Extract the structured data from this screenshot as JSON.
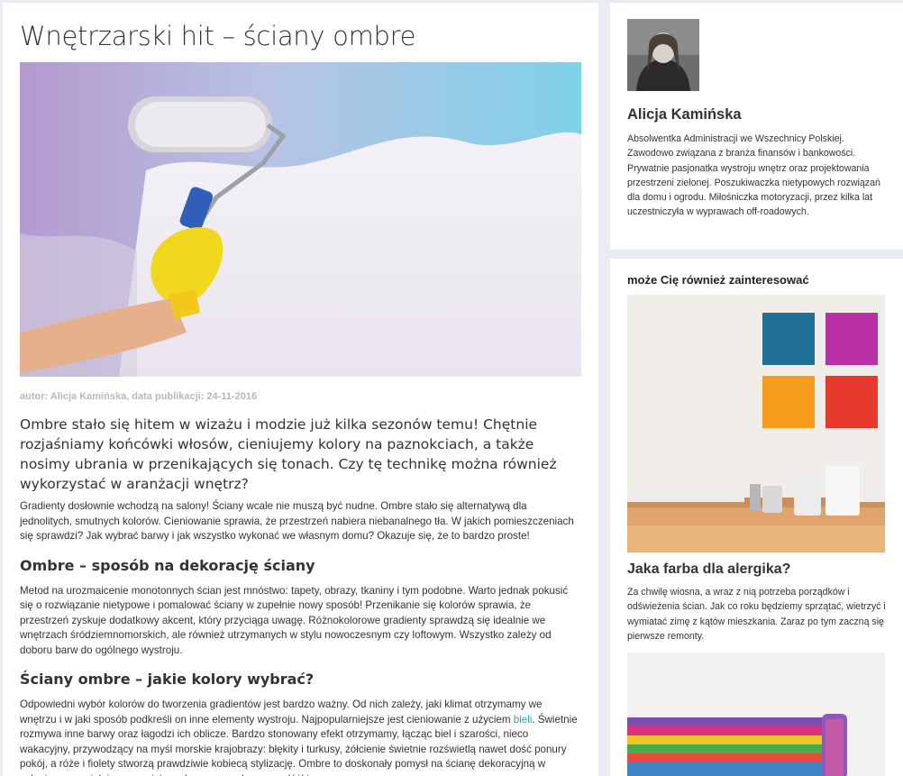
{
  "article": {
    "title": "Wnętrzarski hit – ściany ombre",
    "meta": "autor: Alicja Kamińska, data publikacji: 24-11-2016",
    "lead": "Ombre stało się hitem w wizażu i modzie już kilka sezonów temu! Chętnie rozjaśniamy końcówki włosów, cieniujemy kolory na paznokciach, a także nosimy ubrania w przenikających się tonach. Czy tę technikę można również wykorzystać w aranżacji wnętrz?",
    "intro": "Gradienty dosłownie wchodzą na salony! Ściany wcale nie muszą być nudne. Ombre stało się alternatywą dla jednolitych, smutnych kolorów. Cieniowanie sprawia, że przestrzeń nabiera niebanalnego tła. W jakich pomieszczeniach się sprawdzi? Jak wybrać barwy i jak wszystko wykonać we własnym domu? Okazuje się, że to bardzo proste!",
    "section1_heading": "Ombre – sposób na dekorację ściany",
    "section1_text": "Metod na urozmaicenie monotonnych ścian jest mnóstwo: tapety, obrazy, tkaniny i tym podobne. Warto jednak pokusić się o rozwiązanie nietypowe i pomalować ściany w zupełnie nowy sposób! Przenikanie się kolorów sprawia, że przestrzeń zyskuje dodatkowy akcent, który przyciąga uwagę. Różnokolorowe gradienty sprawdzą się idealnie we wnętrzach śródziemnomorskich, ale również utrzymanych w stylu nowoczesnym czy loftowym. Wszystko zależy od doboru barw do ogólnego wystroju.",
    "section2_heading": "Ściany ombre – jakie kolory wybrać?",
    "section2_text_a": "Odpowiedni wybór kolorów do tworzenia gradientów jest bardzo ważny. Od nich zależy, jaki klimat otrzymamy we wnętrzu i w jaki sposób podkreśli on inne elementy wystroju. Najpopularniejsze jest cieniowanie z użyciem ",
    "section2_link": "bieli",
    "section2_text_b": ". Świetnie rozmywa inne barwy oraz łagodzi ich oblicze. Bardzo stonowany efekt otrzymamy, łącząc biel i szarości, nieco wakacyjny, przywodzący na myśl morskie krajobrazy: błękity i turkusy, żółcienie świetnie rozświetlą nawet dość ponury pokój, a róże i fiolety stworzą prawdziwie kobiecą stylizację. Ombre to doskonały pomysł na ścianę dekoracyjną w salonie czy sypialni, np. w miejscu do wypoczynku czy za łóżkiem."
  },
  "author": {
    "name": "Alicja Kamińska",
    "bio": "Absolwentka Administracji we Wszechnicy Polskiej. Zawodowo związana z branża finansów i bankowości. Prywatnie pasjonatka wystroju wnętrz oraz projektowania przestrzeni zielonej. Poszukiwaczka nietypowych rozwiązań dla domu i ogrodu. Miłośniczka motoryzacji, przez kilka lat uczestniczyła w wyprawach off-roadowych."
  },
  "related": {
    "heading": "może Cię również zainteresować",
    "items": [
      {
        "title": "Jaka farba dla alergika?",
        "excerpt": "Za chwilę wiosna, a wraz z nią potrzeba porządków i odświeżenia ścian. Jak co roku będziemy sprzątać, wietrzyć i wymiatać zimę z kątów mieszkania. Zaraz po tym zaczną się pierwsze remonty."
      }
    ]
  },
  "colors": {
    "background": "#e9ecf0",
    "card": "#ffffff",
    "text": "#333333",
    "link": "#2aa7a0",
    "meta": "#b8b8b8"
  }
}
